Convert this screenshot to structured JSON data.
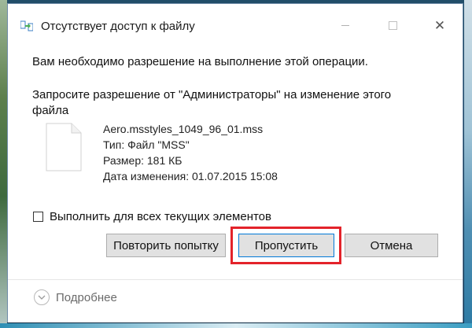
{
  "window": {
    "title": "Отсутствует доступ к файлу",
    "minimize_icon": "minimize-icon",
    "maximize_icon": "maximize-icon",
    "close_glyph": "✕"
  },
  "message": {
    "main": "Вам необходимо разрешение на выполнение этой операции.",
    "request": "Запросите разрешение от \"Администраторы\" на изменение этого файла"
  },
  "file": {
    "icon": "file-icon",
    "name": "Aero.msstyles_1049_96_01.mss",
    "type": "Тип: Файл \"MSS\"",
    "size": "Размер: 181 КБ",
    "modified": "Дата изменения: 01.07.2015 15:08"
  },
  "apply_all": {
    "label": "Выполнить для всех текущих элементов",
    "checked": false
  },
  "buttons": {
    "retry": "Повторить попытку",
    "skip": "Пропустить",
    "cancel": "Отмена"
  },
  "footer": {
    "more_label": "Подробнее",
    "icon": "chevron-down-icon"
  },
  "colors": {
    "highlight": "#e3232a",
    "focus_border": "#0078d7"
  }
}
